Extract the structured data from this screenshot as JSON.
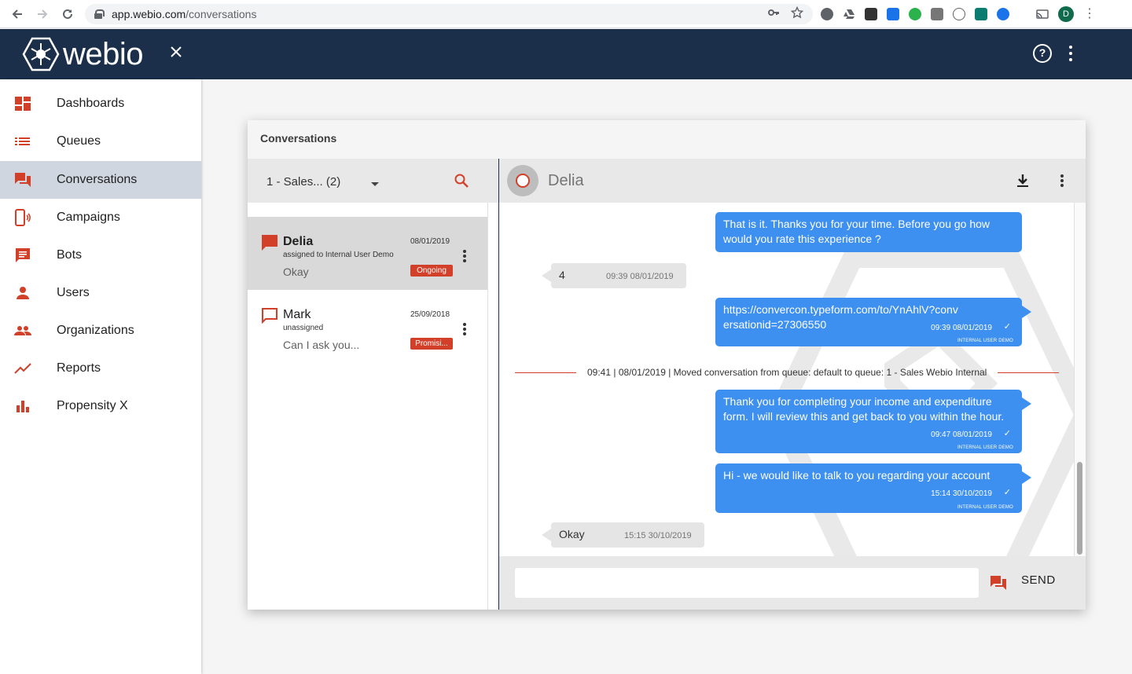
{
  "browser": {
    "url_host": "app.webio.com",
    "url_path": "/conversations",
    "profile_initial": "D"
  },
  "header": {
    "logo_text": "webio",
    "close_icon": "close-icon",
    "help_icon": "help-circle-icon",
    "menu_icon": "kebab-menu-icon",
    "brand_color": "#1b2f4b",
    "accent_color": "#d2402a"
  },
  "sidebar": {
    "items": [
      {
        "label": "Dashboards",
        "icon": "dashboard-icon",
        "active": false
      },
      {
        "label": "Queues",
        "icon": "list-icon",
        "active": false
      },
      {
        "label": "Conversations",
        "icon": "chat-icon",
        "active": true
      },
      {
        "label": "Campaigns",
        "icon": "phone-broadcast-icon",
        "active": false
      },
      {
        "label": "Bots",
        "icon": "message-text-icon",
        "active": false
      },
      {
        "label": "Users",
        "icon": "person-icon",
        "active": false
      },
      {
        "label": "Organizations",
        "icon": "people-icon",
        "active": false
      },
      {
        "label": "Reports",
        "icon": "trending-icon",
        "active": false
      },
      {
        "label": "Propensity X",
        "icon": "bar-chart-icon",
        "active": false
      }
    ]
  },
  "card": {
    "title": "Conversations",
    "queue_select": "1 - Sales... (2)"
  },
  "conversations": [
    {
      "name": "Delia",
      "assignment": "assigned to Internal User Demo",
      "preview": "Okay",
      "date": "08/01/2019",
      "status": "Ongoing",
      "selected": true
    },
    {
      "name": "Mark",
      "assignment": "unassigned",
      "preview": "Can I ask you...",
      "date": "25/09/2018",
      "status": "Promisi...",
      "selected": false
    }
  ],
  "chat": {
    "contact_name": "Delia",
    "messages": [
      {
        "direction": "out",
        "text": "That is it. Thanks you for your time. Before you go how would you rate this experience ?",
        "time": "",
        "agent": ""
      },
      {
        "direction": "in",
        "text": "4",
        "time": "09:39 08/01/2019"
      },
      {
        "direction": "out",
        "text": "https://convercon.typeform.com/to/YnAhlV?conversationid=27306550",
        "time": "09:39 08/01/2019",
        "agent": "INTERNAL USER DEMO"
      },
      {
        "direction": "out",
        "text": "Thank you for completing your income and expenditure form. I will review this and get back to you within the hour.",
        "time": "09:47 08/01/2019",
        "agent": "INTERNAL USER DEMO"
      },
      {
        "direction": "out",
        "text": "Hi - we would like to talk to you regarding your account",
        "time": "15:14 30/10/2019",
        "agent": "INTERNAL USER DEMO"
      },
      {
        "direction": "in",
        "text": "Okay",
        "time": "15:15 30/10/2019"
      }
    ],
    "system_event": "09:41 | 08/01/2019 | Moved conversation from queue: default to queue: 1 - Sales Webio Internal",
    "composer_placeholder": "",
    "send_label": "SEND"
  }
}
